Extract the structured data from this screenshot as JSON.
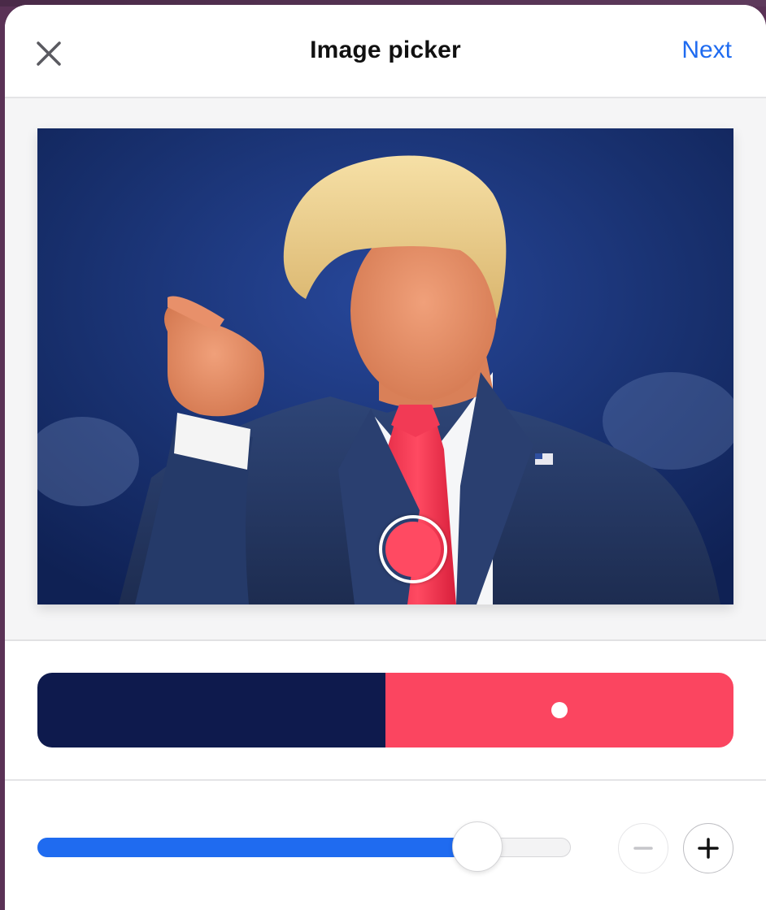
{
  "header": {
    "title": "Image picker",
    "next_label": "Next",
    "close_icon": "close-icon"
  },
  "photo": {
    "description_icon": "photo-image",
    "picker": {
      "icon": "color-picker-ring",
      "sampled_color": "#ff4a62"
    }
  },
  "palette": {
    "swatches": [
      {
        "color": "#0e1a4d",
        "selected": false
      },
      {
        "color": "#fb4560",
        "selected": true
      }
    ]
  },
  "controls": {
    "slider_value": 0.825,
    "minus_icon": "minus-icon",
    "plus_icon": "plus-icon",
    "minus_enabled": false,
    "plus_enabled": true
  },
  "colors": {
    "accent": "#1f6bf0",
    "divider": "#e4e4e6",
    "image_background": "#f5f5f6"
  }
}
